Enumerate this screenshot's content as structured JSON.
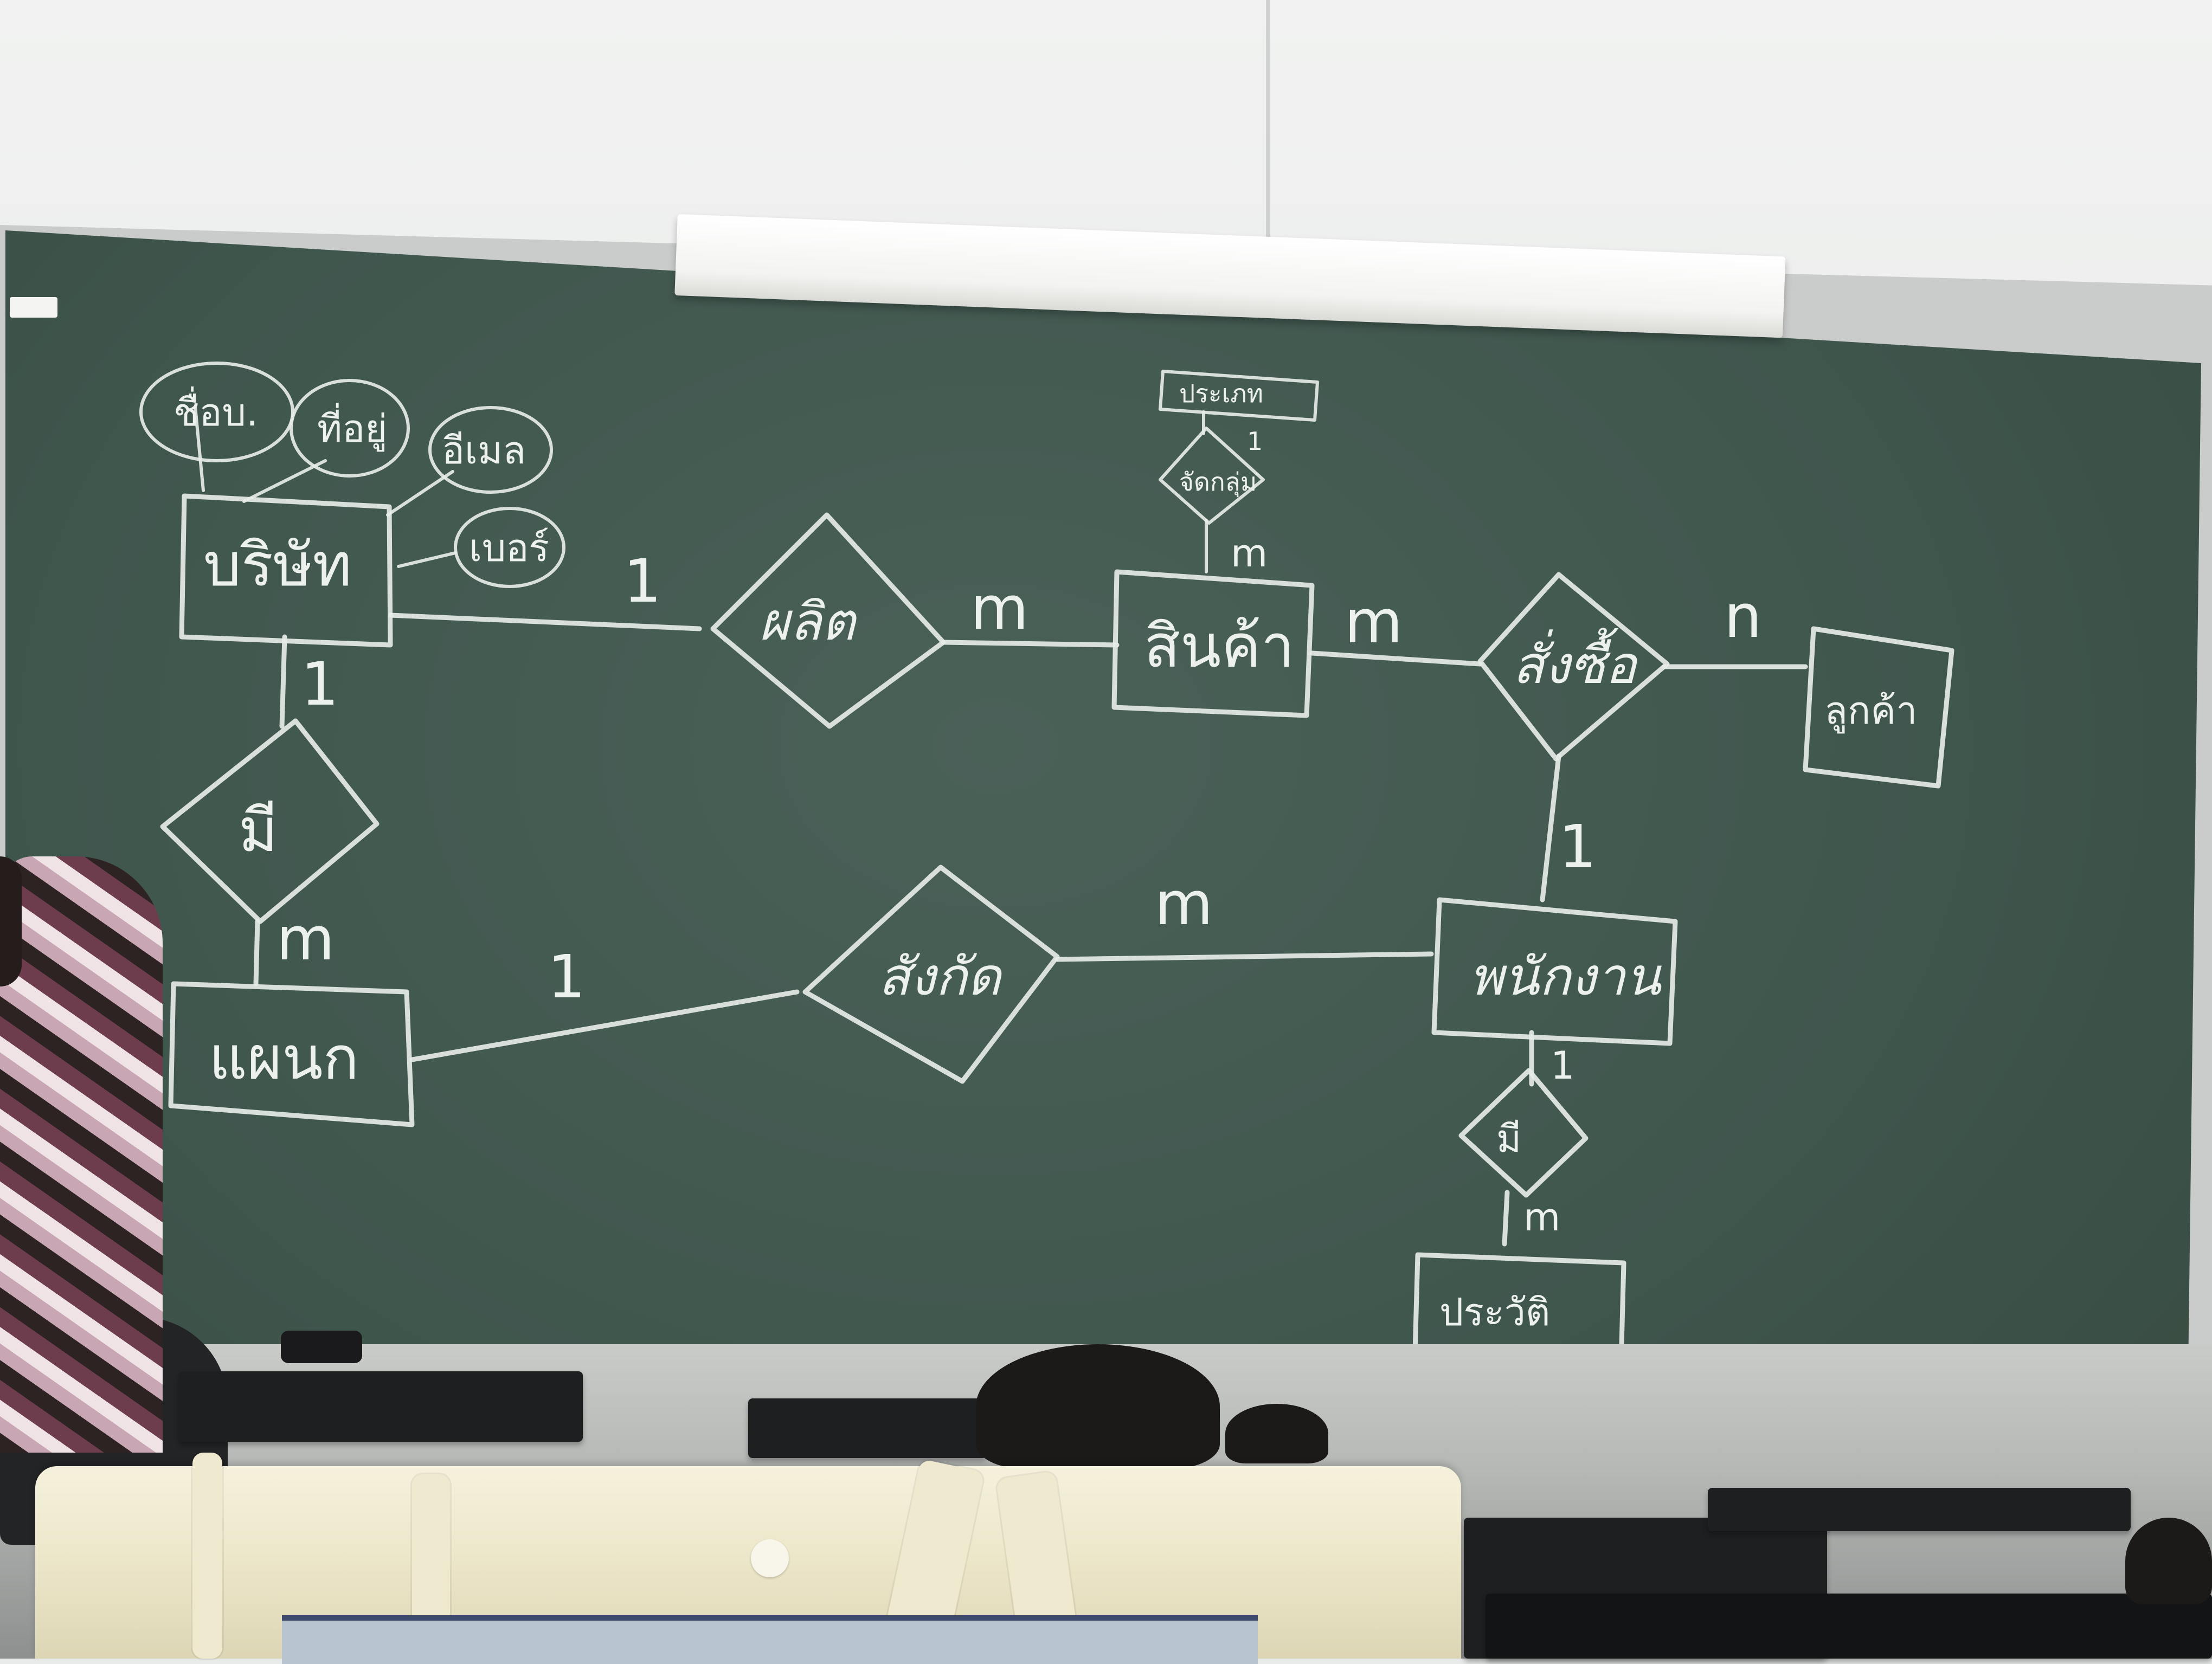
{
  "diagram": {
    "entities": [
      {
        "id": "company",
        "label": "บริษัท"
      },
      {
        "id": "product",
        "label": "สินค้า"
      },
      {
        "id": "customer",
        "label": "ลูกค้า"
      },
      {
        "id": "department",
        "label": "แผนก"
      },
      {
        "id": "employee",
        "label": "พนักงาน"
      },
      {
        "id": "history",
        "label": "ประวัติ"
      },
      {
        "id": "category",
        "label": "ประเภท"
      }
    ],
    "relationships": [
      {
        "id": "produce",
        "label": "ผลิต"
      },
      {
        "id": "buy",
        "label": "สั่งซื้อ"
      },
      {
        "id": "has_dept",
        "label": "มี"
      },
      {
        "id": "belongs",
        "label": "สังกัด"
      },
      {
        "id": "has_history",
        "label": "มี"
      },
      {
        "id": "classify",
        "label": "จัดกลุ่ม"
      }
    ],
    "attributes": [
      {
        "id": "name",
        "label": "ชื่อบ."
      },
      {
        "id": "address",
        "label": "ที่อยู่"
      },
      {
        "id": "email",
        "label": "อีเมล"
      },
      {
        "id": "phone",
        "label": "เบอร์"
      }
    ],
    "cardinalities": {
      "company_produce": "1",
      "produce_product": "m",
      "product_buy": "m",
      "buy_customer": "n",
      "company_hasdept": "1",
      "hasdept_department": "m",
      "department_belongs": "1",
      "belongs_employee": "m",
      "employee_buy": "1",
      "employee_hashistory": "1",
      "hashistory_history": "m",
      "category_classify": "1",
      "classify_product": "m"
    }
  }
}
